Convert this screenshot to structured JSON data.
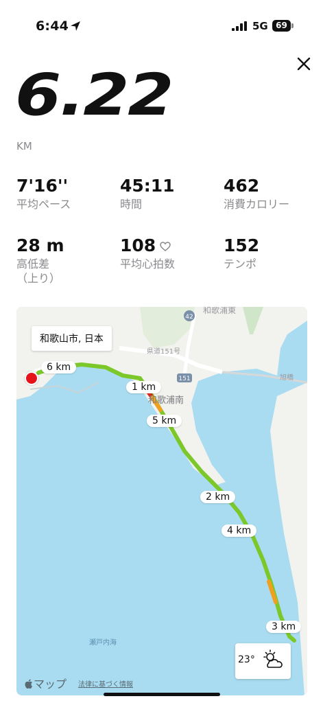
{
  "status": {
    "time": "6:44",
    "network": "5G",
    "battery": "69"
  },
  "summary": {
    "distance": "6.22",
    "unit": "KM"
  },
  "stats": [
    {
      "value": "7'16''",
      "label": "平均ペース"
    },
    {
      "value": "45:11",
      "label": "時間"
    },
    {
      "value": "462",
      "label": "消費カロリー"
    },
    {
      "value": "28 m",
      "label": "高低差\n（上り）"
    },
    {
      "value": "108",
      "label": "平均心拍数"
    },
    {
      "value": "152",
      "label": "テンポ"
    }
  ],
  "map": {
    "place": "和歌山市, 日本",
    "km_labels": [
      "6 km",
      "1 km",
      "5 km",
      "2 km",
      "4 km",
      "3 km"
    ],
    "area_label": "和歌浦南",
    "area_label_top": "和歌浦東",
    "road_label": "県道151号",
    "route_num_1": "42",
    "route_num_2": "151",
    "bridge_label": "旭橋",
    "sea_label": "瀬戸内海",
    "weather_temp": "23°",
    "brand": "マップ",
    "legal": "法律に基づく情報"
  },
  "colors": {
    "route_green": "#7cc82a",
    "route_red": "#e0281e",
    "water": "#a9dcf1",
    "land": "#f2f2ee"
  },
  "icons": [
    "location-arrow-icon",
    "signal-icon",
    "battery-icon",
    "close-icon",
    "heart-icon",
    "partly-cloudy-icon",
    "apple-icon"
  ]
}
